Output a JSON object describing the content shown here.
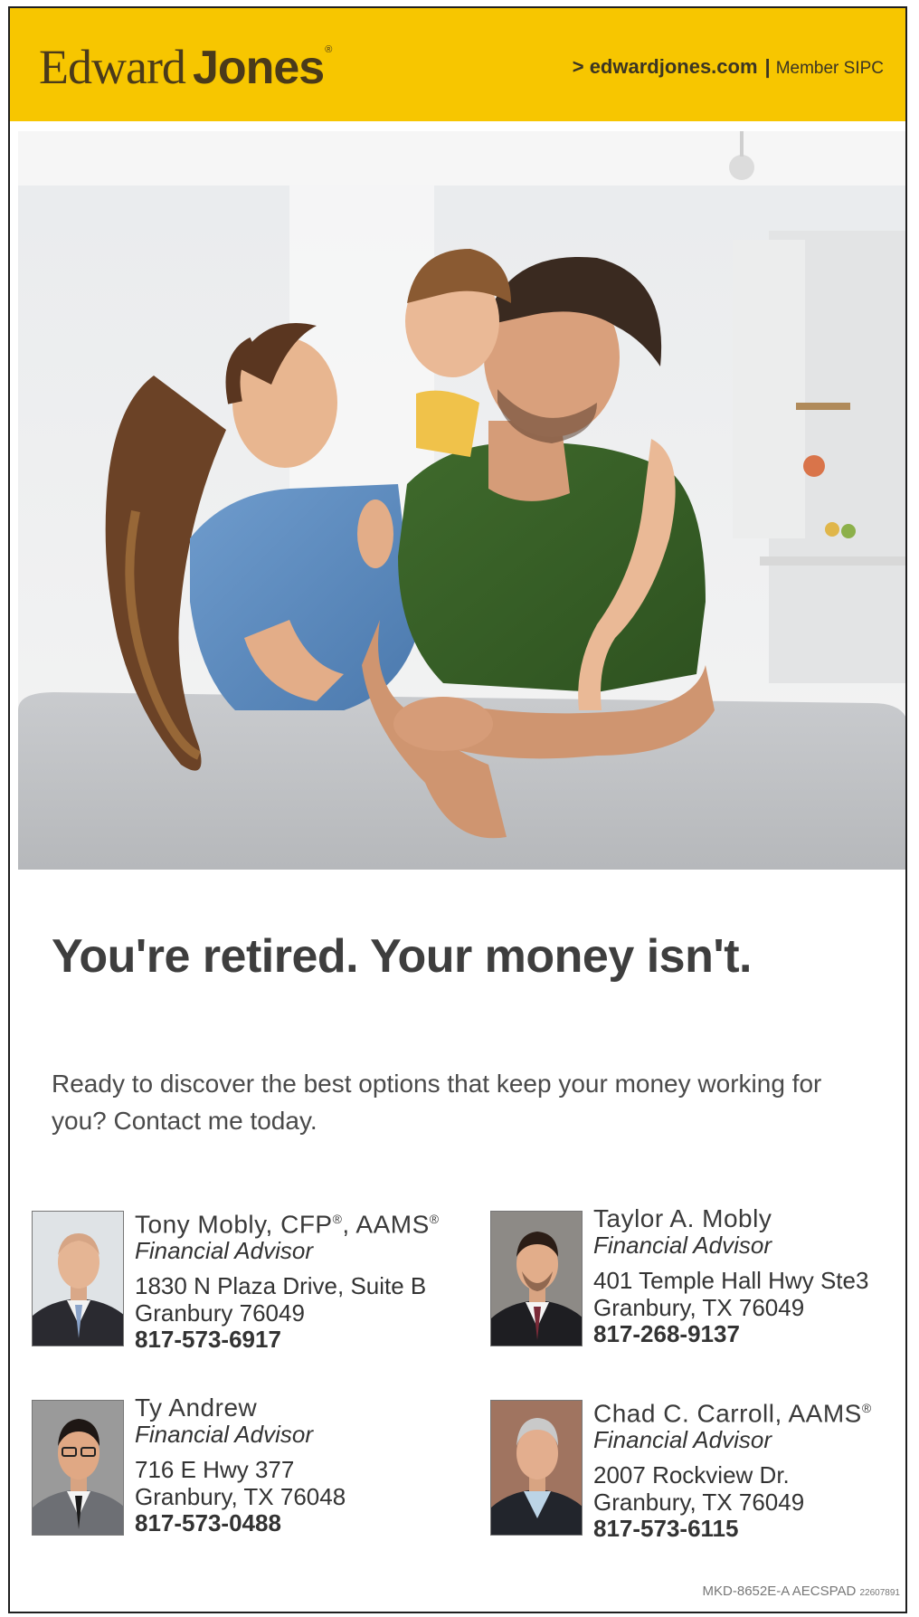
{
  "header": {
    "logo_word1": "Edward",
    "logo_word2": "Jones",
    "logo_reg": "®",
    "url": "> edwardjones.com",
    "separator": "|",
    "member": "Member SIPC"
  },
  "headline": "You're retired. Your money isn't.",
  "body_copy": "Ready to discover the best options that keep your money working for you? Contact me today.",
  "advisors": [
    {
      "name": "Tony Mobly, CFP",
      "name_sup1": "®",
      "name_mid": ", AAMS",
      "name_sup2": "®",
      "title": "Financial Advisor",
      "address_line1": "1830 N Plaza Drive, Suite B",
      "address_line2": "Granbury 76049",
      "phone": "817-573-6917"
    },
    {
      "name": "Taylor A. Mobly",
      "name_sup1": "",
      "name_mid": "",
      "name_sup2": "",
      "title": "Financial Advisor",
      "address_line1": "401 Temple Hall Hwy Ste3",
      "address_line2": "Granbury, TX 76049",
      "phone": "817-268-9137"
    },
    {
      "name": "Ty Andrew",
      "name_sup1": "",
      "name_mid": "",
      "name_sup2": "",
      "title": "Financial Advisor",
      "address_line1": "716 E Hwy 377",
      "address_line2": "Granbury, TX 76048",
      "phone": "817-573-0488"
    },
    {
      "name": "Chad C. Carroll, AAMS",
      "name_sup1": "®",
      "name_mid": "",
      "name_sup2": "",
      "title": "Financial Advisor",
      "address_line1": "2007 Rockview Dr.",
      "address_line2": "Granbury, TX 76049",
      "phone": "817-573-6115"
    }
  ],
  "footer": {
    "code": "MKD-8652E-A AECSPAD",
    "code_small": "22607891"
  },
  "colors": {
    "brand_yellow": "#f7c600",
    "logo_brown": "#4a3a1a",
    "text_dark": "#3e3e3e"
  }
}
